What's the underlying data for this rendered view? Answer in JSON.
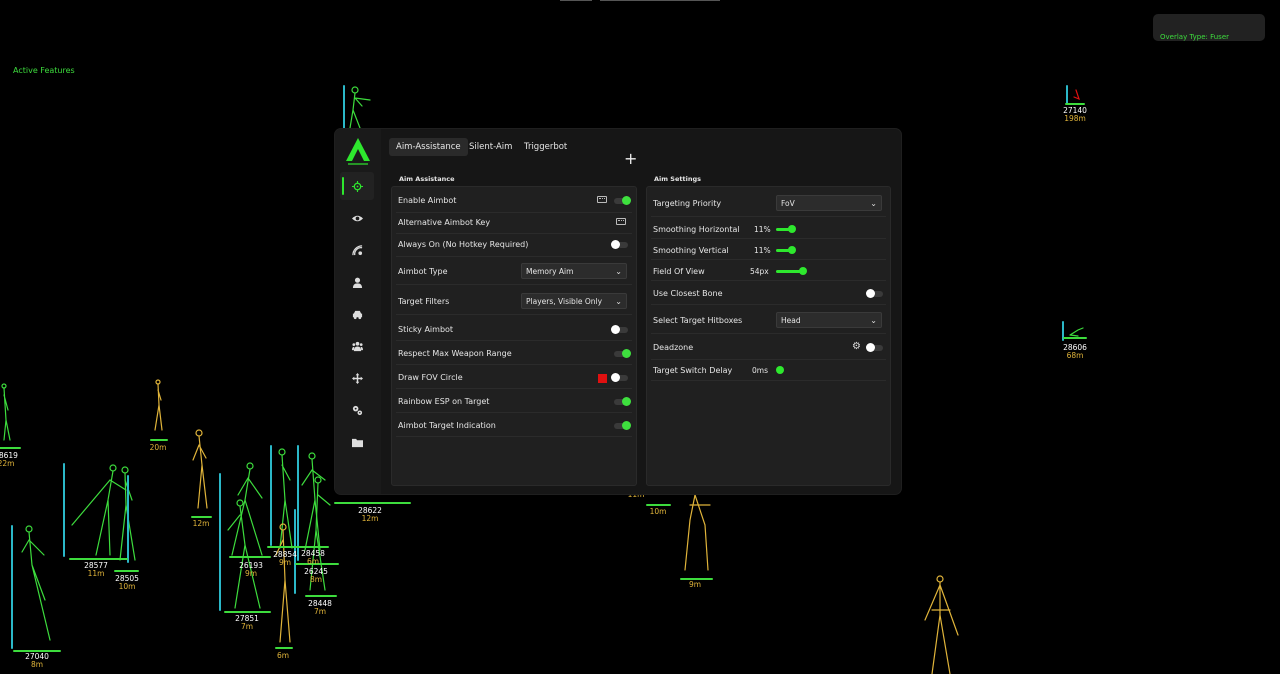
{
  "hud": {
    "active_features": "Active Features",
    "overlay_type": "Overlay Type: Fuser"
  },
  "esp_labels": [
    {
      "id": "27140",
      "dist": "198m"
    },
    {
      "id": "28606",
      "dist": "68m"
    },
    {
      "id": "28619",
      "dist": "22m"
    },
    {
      "id": "",
      "dist": "20m"
    },
    {
      "id": "",
      "dist": "12m"
    },
    {
      "id": "28577",
      "dist": "11m"
    },
    {
      "id": "28505",
      "dist": "10m"
    },
    {
      "id": "26193",
      "dist": "9m"
    },
    {
      "id": "28854",
      "dist": "9m"
    },
    {
      "id": "28458",
      "dist": "6m"
    },
    {
      "id": "26245",
      "dist": "8m"
    },
    {
      "id": "28448",
      "dist": "7m"
    },
    {
      "id": "27851",
      "dist": "7m"
    },
    {
      "id": "27040",
      "dist": "8m"
    },
    {
      "id": "",
      "dist": "6m"
    },
    {
      "id": "28622",
      "dist": "12m"
    },
    {
      "id": "",
      "dist": "10m"
    },
    {
      "id": "",
      "dist": "11m"
    },
    {
      "id": "",
      "dist": "9m"
    }
  ],
  "menu": {
    "tabs": [
      "Aim-Assistance",
      "Silent-Aim",
      "Triggerbot"
    ],
    "nav_icons": [
      "crosshair-icon",
      "eye-icon",
      "radar-icon",
      "person-icon",
      "car-icon",
      "group-icon",
      "move-icon",
      "settings-icon",
      "folder-icon"
    ],
    "left": {
      "title": "Aim Assistance",
      "rows": [
        {
          "label": "Enable Aimbot",
          "toggle": "on",
          "keybind": true
        },
        {
          "label": "Alternative Aimbot Key",
          "keybind": true
        },
        {
          "label": "Always On (No Hotkey Required)",
          "toggle": "off"
        },
        {
          "label": "Aimbot Type",
          "select": "Memory Aim"
        },
        {
          "label": "Target Filters",
          "select": "Players, Visible Only"
        },
        {
          "label": "Sticky Aimbot",
          "toggle": "off"
        },
        {
          "label": "Respect Max Weapon Range",
          "toggle": "on"
        },
        {
          "label": "Draw FOV Circle",
          "toggle": "off",
          "color": "#e01010"
        },
        {
          "label": "Rainbow ESP on Target",
          "toggle": "on"
        },
        {
          "label": "Aimbot Target Indication",
          "toggle": "on"
        }
      ]
    },
    "right": {
      "title": "Aim Settings",
      "rows": [
        {
          "label": "Targeting Priority",
          "select": "FoV"
        },
        {
          "label": "Smoothing Horizontal",
          "value": "11%",
          "level": 0.11
        },
        {
          "label": "Smoothing Vertical",
          "value": "11%",
          "level": 0.11
        },
        {
          "label": "Field Of View",
          "value": "54px",
          "level": 0.3
        },
        {
          "label": "Use Closest Bone",
          "toggle": "off"
        },
        {
          "label": "Select Target Hitboxes",
          "select": "Head"
        },
        {
          "label": "Deadzone",
          "toggle": "off",
          "gear": true
        },
        {
          "label": "Target Switch Delay",
          "value": "0ms",
          "level": 0
        }
      ]
    }
  },
  "colors": {
    "accent": "#2ee82e",
    "esp_green": "#3ddc3d",
    "esp_yellow": "#e0b43a",
    "esp_cyan": "#2bb8c8"
  }
}
